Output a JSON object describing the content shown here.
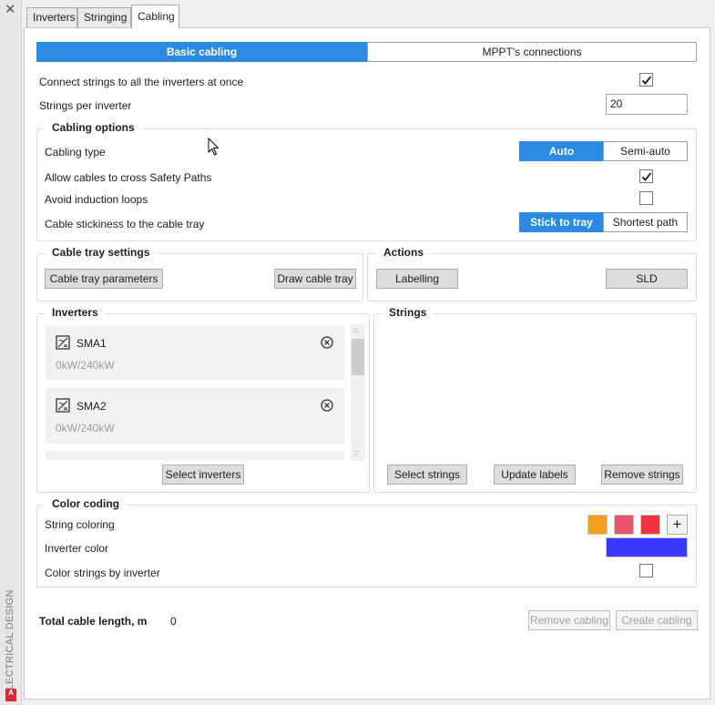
{
  "window": {
    "close_glyph": "✕",
    "side_label": "ELECTRICAL DESIGN",
    "app_badge": "A"
  },
  "tabs": [
    {
      "label": "Inverters"
    },
    {
      "label": "Stringing"
    },
    {
      "label": "Cabling",
      "active": true
    }
  ],
  "mode_switch": {
    "basic": "Basic cabling",
    "mppt": "MPPT's connections",
    "selected": "Basic cabling"
  },
  "general": {
    "connect_all_label": "Connect strings to all the inverters at once",
    "connect_all_checked": true,
    "strings_per_inverter_label": "Strings per inverter",
    "strings_per_inverter_value": "20"
  },
  "cabling_options": {
    "title": "Cabling options",
    "type_label": "Cabling type",
    "type_auto": "Auto",
    "type_semi": "Semi-auto",
    "type_selected": "Auto",
    "safety_label": "Allow cables to cross Safety Paths",
    "safety_checked": true,
    "induction_label": "Avoid induction loops",
    "induction_checked": false,
    "stickiness_label": "Cable stickiness to the cable tray",
    "stick_label": "Stick to tray",
    "shortest_label": "Shortest path",
    "stickiness_selected": "Stick to tray"
  },
  "cable_tray": {
    "title": "Cable tray settings",
    "params_button": "Cable tray parameters",
    "draw_button": "Draw cable tray"
  },
  "actions": {
    "title": "Actions",
    "labelling_button": "Labelling",
    "sld_button": "SLD"
  },
  "inverters": {
    "title": "Inverters",
    "items": [
      {
        "name": "SMA1",
        "power": "0kW/240kW"
      },
      {
        "name": "SMA2",
        "power": "0kW/240kW"
      }
    ],
    "select_button": "Select inverters",
    "icon": "inverter-icon"
  },
  "strings": {
    "title": "Strings",
    "select_button": "Select strings",
    "update_button": "Update labels",
    "remove_button": "Remove strings"
  },
  "color_coding": {
    "title": "Color coding",
    "string_coloring_label": "String coloring",
    "string_colors": [
      "#f5a01a",
      "#e8546c",
      "#f5333d"
    ],
    "add_glyph": "+",
    "inverter_color_label": "Inverter color",
    "inverter_color": "#3a38ff",
    "by_inverter_label": "Color strings by inverter",
    "by_inverter_checked": false
  },
  "footer": {
    "total_label": "Total cable length, m",
    "total_value": "0",
    "remove_button": "Remove cabling",
    "create_button": "Create cabling"
  },
  "colors": {
    "accent": "#2b8ae2"
  }
}
